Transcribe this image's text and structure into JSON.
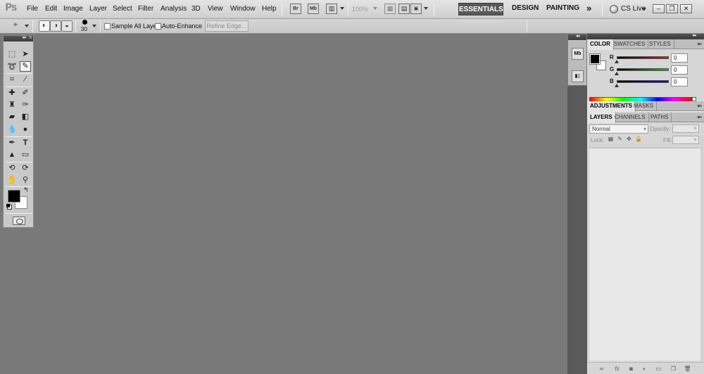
{
  "app": {
    "logo": "Ps"
  },
  "menu": [
    "File",
    "Edit",
    "Image",
    "Layer",
    "Select",
    "Filter",
    "Analysis",
    "3D",
    "View",
    "Window",
    "Help"
  ],
  "appbar": {
    "bridge_label": "Br",
    "minibridge_label": "Mb",
    "zoom": "100%",
    "workspaces": [
      "ESSENTIALS",
      "DESIGN",
      "PAINTING"
    ],
    "more_label": "»",
    "cs_live": "CS Live"
  },
  "window_controls": {
    "minimize": "–",
    "restore": "❐",
    "close": "✕"
  },
  "options": {
    "brush_size": "30",
    "sample_all_layers": "Sample All Layers",
    "auto_enhance": "Auto-Enhance",
    "refine_edge": "Refine Edge..."
  },
  "color_panel": {
    "tabs": [
      "COLOR",
      "SWATCHES",
      "STYLES"
    ],
    "channels": [
      {
        "label": "R",
        "value": "0",
        "color": "#ff0000"
      },
      {
        "label": "G",
        "value": "0",
        "color": "#00cc00"
      },
      {
        "label": "B",
        "value": "0",
        "color": "#0000ff"
      }
    ],
    "foreground": "#000000",
    "background": "#ffffff"
  },
  "adjustments_panel": {
    "tabs": [
      "ADJUSTMENTS",
      "MASKS"
    ]
  },
  "layers_panel": {
    "tabs": [
      "LAYERS",
      "CHANNELS",
      "PATHS"
    ],
    "blend_mode": "Normal",
    "opacity_label": "Opacity:",
    "lock_label": "Lock:",
    "fill_label": "Fill:"
  },
  "tools": [
    "rectangular-marquee",
    "move",
    "lasso",
    "quick-selection",
    "crop",
    "eyedropper",
    "spot-healing-brush",
    "brush",
    "clone-stamp",
    "history-brush",
    "eraser",
    "gradient",
    "blur",
    "dodge",
    "pen",
    "type",
    "path-selection",
    "rectangle",
    "3d-rotate",
    "3d-orbit",
    "hand",
    "zoom"
  ]
}
